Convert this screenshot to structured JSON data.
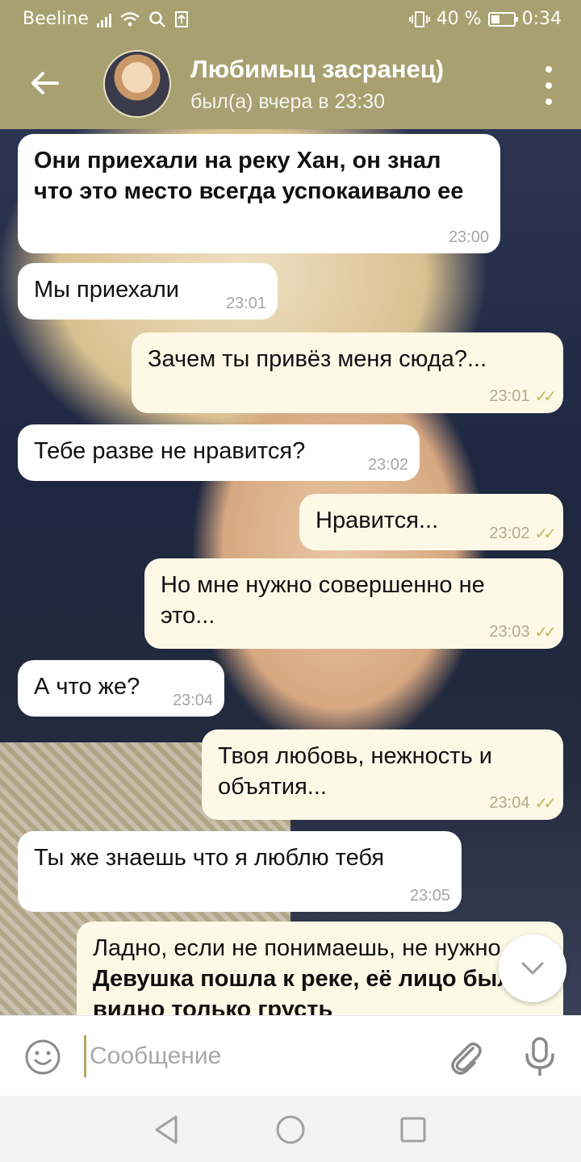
{
  "status_bar": {
    "carrier": "Beeline",
    "battery": "40 %",
    "time": "0:34",
    "battery_level": 0.4
  },
  "header": {
    "title": "Любимыц засранец)",
    "status": "был(а) вчера в 23:30"
  },
  "messages": [
    {
      "dir": "in",
      "text": "Они приехали на реку Хан, он знал что это место всегда успокаивало ее",
      "time": "23:00"
    },
    {
      "dir": "in",
      "text": "Мы приехали",
      "time": "23:01"
    },
    {
      "dir": "out",
      "text": "Зачем ты привёз меня сюда?...",
      "time": "23:01"
    },
    {
      "dir": "in",
      "text": "Тебе разве не нравится?",
      "time": "23:02"
    },
    {
      "dir": "out",
      "text": "Нравится...",
      "time": "23:02"
    },
    {
      "dir": "out",
      "text": "Но мне нужно совершенно не это...",
      "time": "23:03"
    },
    {
      "dir": "in",
      "text": "А что же?",
      "time": "23:04"
    },
    {
      "dir": "out",
      "text": "Твоя любовь, нежность и объятия...",
      "time": "23:04"
    },
    {
      "dir": "in",
      "text": "Ты же знаешь что я люблю тебя",
      "time": "23:05"
    },
    {
      "dir": "out",
      "text_plain": "Ладно, если не понимаешь, не нужно... ",
      "text_bold": "Девушка пошла к реке, её лицо было видно только грусть",
      "time": ""
    }
  ],
  "input": {
    "placeholder": "Сообщение"
  },
  "icons": {
    "back": "arrow-left-icon",
    "menu": "more-vertical-icon",
    "scroll_down": "chevron-down-icon",
    "emoji": "smiley-icon",
    "attach": "paperclip-icon",
    "mic": "microphone-icon",
    "nav_back": "triangle-back-icon",
    "nav_home": "circle-home-icon",
    "nav_recent": "square-recents-icon"
  },
  "colors": {
    "header": "#a8a070",
    "outgoing_bubble": "#fdf9e6",
    "incoming_bubble": "#ffffff",
    "read_ticks": "#c6b560"
  }
}
